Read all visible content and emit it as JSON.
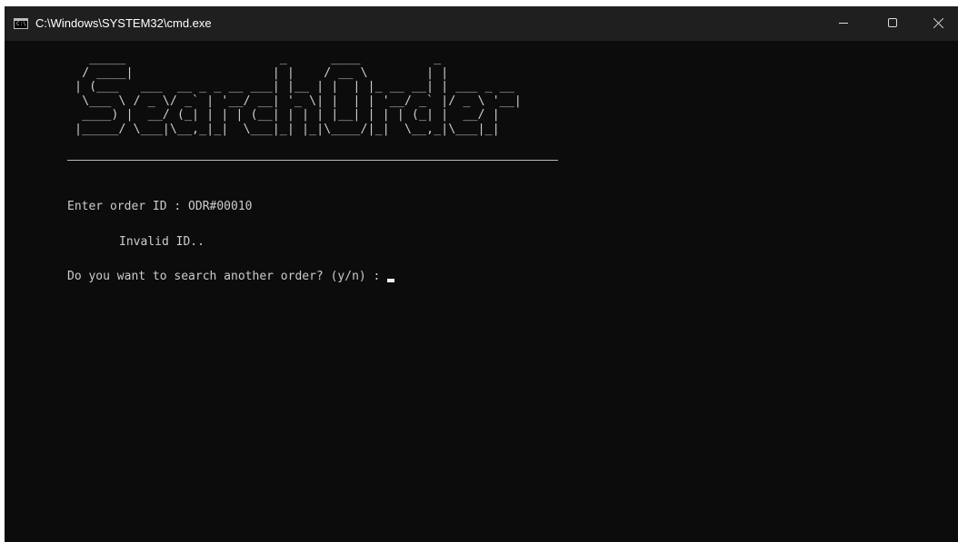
{
  "window": {
    "title": "C:\\Windows\\SYSTEM32\\cmd.exe",
    "app_icon": "console-app-icon",
    "controls": {
      "minimize_icon": "minimize-icon",
      "maximize_icon": "maximize-icon",
      "close_icon": "close-icon"
    }
  },
  "console": {
    "banner": "   _____                     _      ____          _           \n  / ____|                   | |    / __ \\        | |          \n | (___   ___  __ _ _ __ ___| |__ | |  | |_ __ __| | ___ _ __ \n  \\___ \\ / _ \\/ _` | '__/ __| '_ \\| |  | | '__/ _` |/ _ \\ '__|\n  ____) |  __/ (_| | | | (__| | | | |__| | | | (_| |  __/ |   \n |_____/ \\___|\\__,_|_|  \\___|_| |_|\\____/|_|  \\__,_|\\___|_|   ",
    "order_prompt": "Enter order ID : ODR#00010",
    "invalid_message": "Invalid ID..",
    "continue_prompt": "Do you want to search another order? (y/n) : "
  },
  "colors": {
    "console_background": "#0c0c0c",
    "titlebar_background": "#1f1f1f",
    "console_text": "#cccccc"
  }
}
